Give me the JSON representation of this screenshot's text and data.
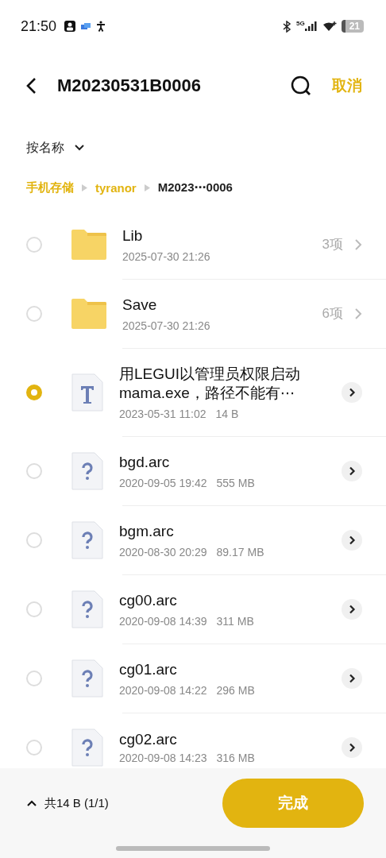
{
  "status_bar": {
    "time": "21:50",
    "network": "5G",
    "battery": "21"
  },
  "header": {
    "title": "M20230531B0006",
    "cancel": "取消"
  },
  "sort": {
    "label": "按名称"
  },
  "breadcrumb": [
    {
      "label": "手机存储",
      "selected": false
    },
    {
      "label": "tyranor",
      "selected": false
    },
    {
      "label": "M2023⋯0006",
      "selected": true
    }
  ],
  "files": [
    {
      "kind": "folder",
      "name": "Lib",
      "meta": "2025-07-30 21:26",
      "count": "3项",
      "selected": false
    },
    {
      "kind": "folder",
      "name": "Save",
      "meta": "2025-07-30 21:26",
      "count": "6项",
      "selected": false
    },
    {
      "kind": "text",
      "name": "用LEGUI以管理员权限启动mama.exe，路径不能有⋯",
      "meta": "2023-05-31 11:02",
      "size": "14 B",
      "selected": true
    },
    {
      "kind": "unknown",
      "name": "bgd.arc",
      "meta": "2020-09-05 19:42",
      "size": "555 MB",
      "selected": false
    },
    {
      "kind": "unknown",
      "name": "bgm.arc",
      "meta": "2020-08-30 20:29",
      "size": "89.17 MB",
      "selected": false
    },
    {
      "kind": "unknown",
      "name": "cg00.arc",
      "meta": "2020-09-08 14:39",
      "size": "311 MB",
      "selected": false
    },
    {
      "kind": "unknown",
      "name": "cg01.arc",
      "meta": "2020-09-08 14:22",
      "size": "296 MB",
      "selected": false
    },
    {
      "kind": "unknown",
      "name": "cg02.arc",
      "meta": "2020-09-08 14:23",
      "size": "316 MB",
      "selected": false
    }
  ],
  "footer": {
    "summary": "共14 B (1/1)",
    "done": "完成"
  }
}
